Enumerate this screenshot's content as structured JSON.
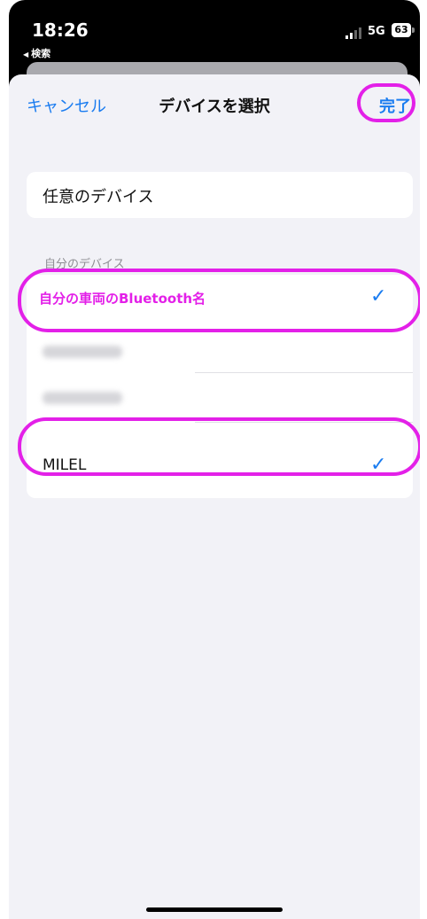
{
  "status_bar": {
    "time": "18:26",
    "back_label": "検索",
    "network": "5G",
    "battery": "63"
  },
  "nav": {
    "cancel_label": "キャンセル",
    "title": "デバイスを選択",
    "done_label": "完了"
  },
  "any_device": {
    "label": "任意のデバイス"
  },
  "my_devices": {
    "header": "自分のデバイス",
    "items": [
      {
        "label": "自分の車両のBluetooth名",
        "selected": true
      },
      {
        "label": "",
        "selected": false,
        "obscured": true
      },
      {
        "label": "",
        "selected": false,
        "obscured": true
      },
      {
        "label": "MILEL",
        "selected": true
      }
    ]
  },
  "colors": {
    "accent": "#1a7cf0",
    "highlight": "#e320e8",
    "background": "#f2f2f7"
  }
}
